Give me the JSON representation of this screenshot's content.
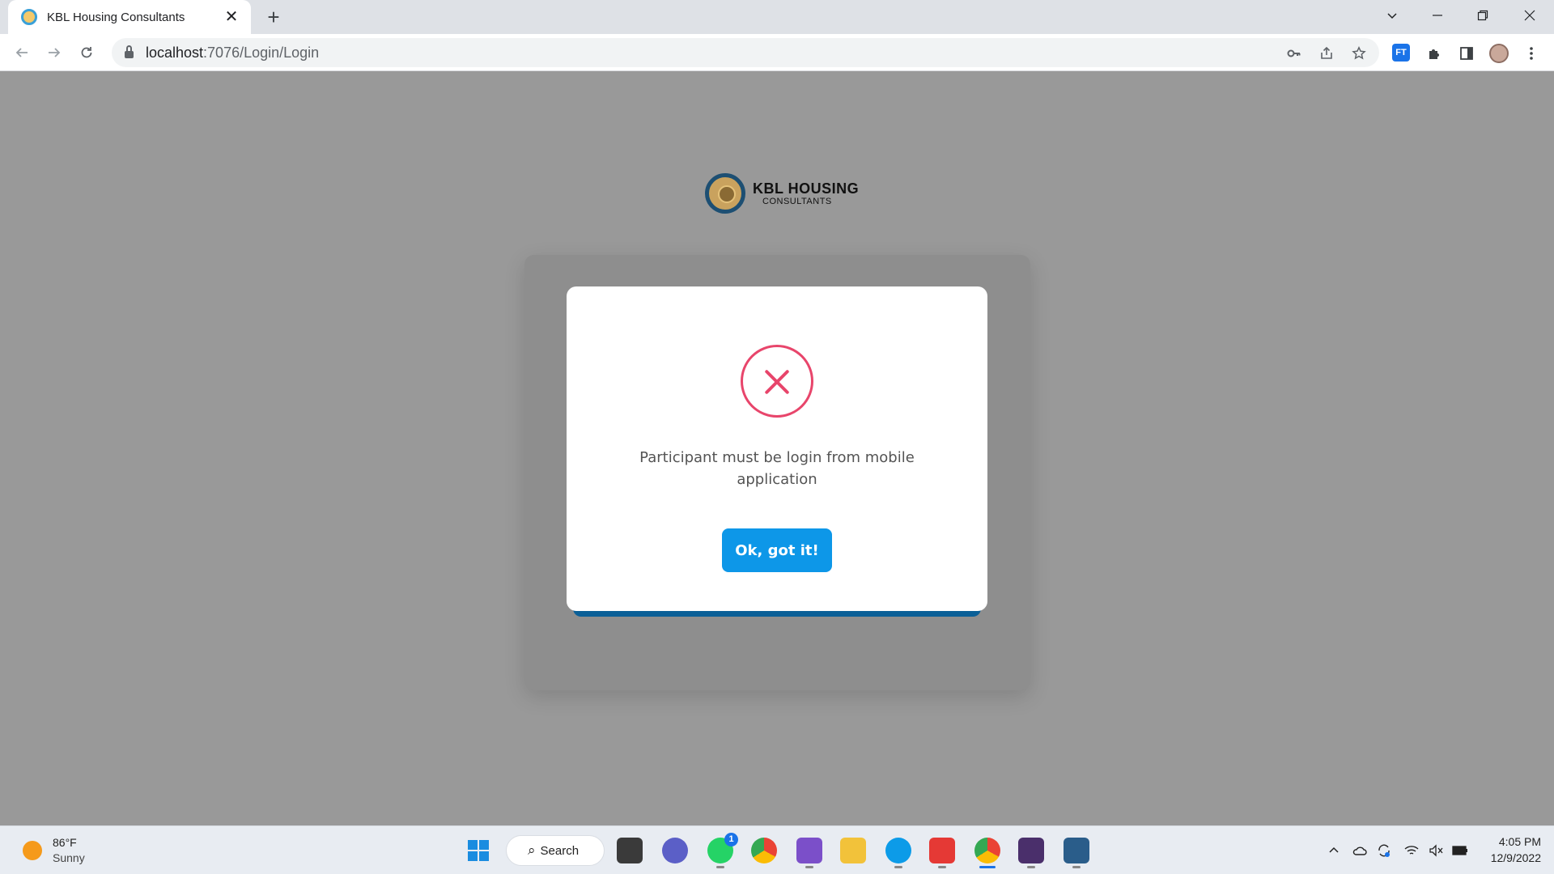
{
  "browser": {
    "tab_title": "KBL Housing Consultants",
    "tab_close": "✕",
    "new_tab": "+",
    "url_host": "localhost",
    "url_path": ":7076/Login/Login",
    "extension_label": "FT"
  },
  "page": {
    "logo_line1": "KBL HOUSING",
    "logo_line2": "CONSULTANTS"
  },
  "modal": {
    "message": "Participant must be login from mobile application",
    "ok_label": "Ok, got it!",
    "icon": "error-x-circle",
    "accent_color": "#e8456b",
    "button_color": "#0d97e8"
  },
  "taskbar": {
    "weather_temp": "86°F",
    "weather_cond": "Sunny",
    "search_label": "Search",
    "whatsapp_badge": "1",
    "clock_time": "4:05 PM",
    "clock_date": "12/9/2022"
  }
}
